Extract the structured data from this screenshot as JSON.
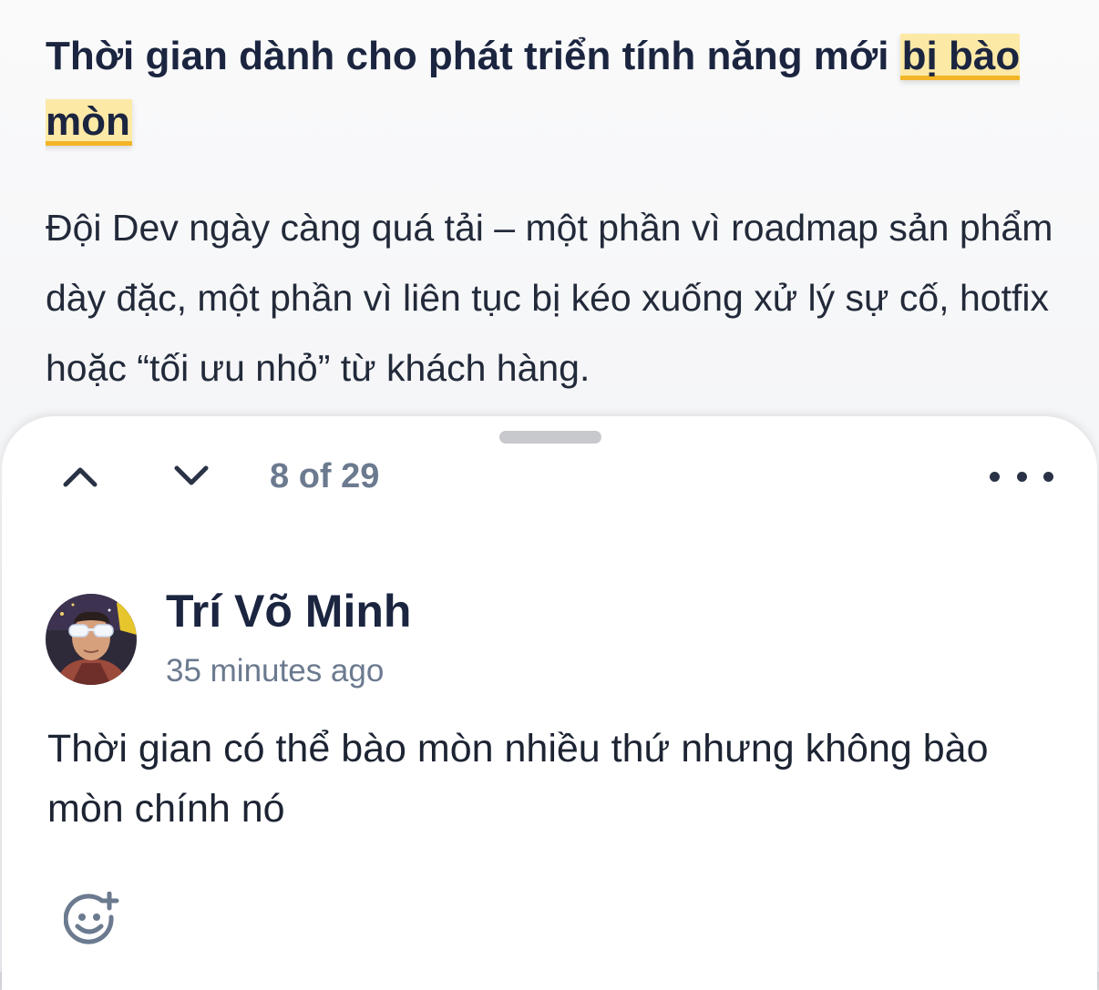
{
  "article": {
    "heading_before": "Thời gian dành cho phát triển tính năng mới ",
    "heading_highlight": "bị bào mòn",
    "paragraph": "Đội Dev ngày càng quá tải – một phần vì roadmap sản phẩm dày đặc, một phần vì liên tục bị kéo xuống xử lý sự cố, hotfix hoặc “tối ưu nhỏ” từ khách hàng."
  },
  "comment_panel": {
    "counter": "8 of 29",
    "comment": {
      "author": "Trí Võ Minh",
      "timestamp": "35 minutes ago",
      "body": "Thời gian có thể bào mòn nhiều thứ nhưng không bào mòn chính nó"
    }
  },
  "icons": {
    "previous": "chevron-up-icon",
    "next": "chevron-down-icon",
    "more": "more-dots-icon",
    "react": "add-reaction-icon",
    "grabber": "drag-handle"
  },
  "colors": {
    "highlight_fill": "#fde9a6",
    "highlight_underline": "#f3b526",
    "text_primary": "#1b2540",
    "text_secondary": "#6b7a8f"
  }
}
